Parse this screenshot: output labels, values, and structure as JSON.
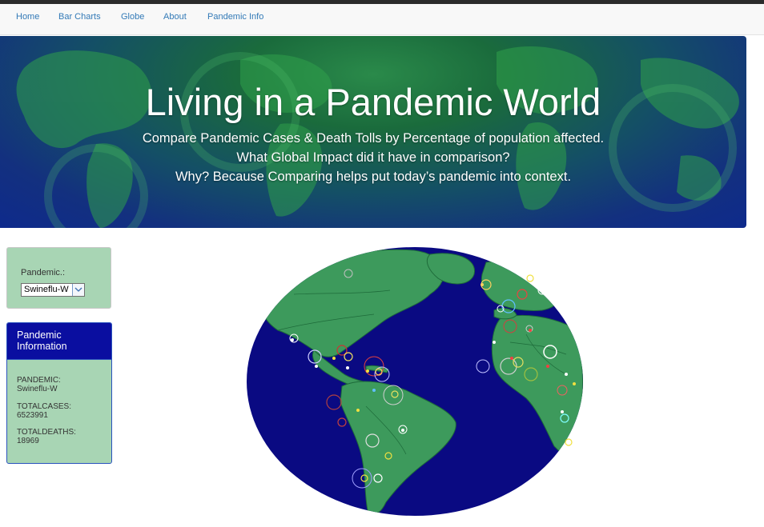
{
  "nav": {
    "items": [
      {
        "label": "Home"
      },
      {
        "label": "Bar Charts"
      },
      {
        "label": "Globe"
      },
      {
        "label": "About"
      },
      {
        "label": "Pandemic Info"
      }
    ]
  },
  "hero": {
    "title": "Living in a Pandemic World",
    "lines": [
      "Compare Pandemic Cases & Death Tolls by Percentage of population affected.",
      "What Global Impact did it have in comparison?",
      "Why? Because Comparing helps put today’s pandemic into context."
    ]
  },
  "selector": {
    "label": "Pandemic.:",
    "selected": "Swineflu-W"
  },
  "info": {
    "title": "Pandemic Information",
    "pandemic_label": "PANDEMIC:",
    "pandemic_value": "Swineflu-W",
    "cases_label": "TOTALCASES:",
    "cases_value": "6523991",
    "deaths_label": "TOTALDEATHS:",
    "deaths_value": "18969"
  },
  "colors": {
    "ocean": "#0a0a82",
    "land": "#3d9a5c",
    "panel_green": "#a8d5b4",
    "info_header": "#0a0ea0",
    "link": "#337ab7"
  },
  "icons": {
    "dropdown": "chevron-down-icon"
  }
}
